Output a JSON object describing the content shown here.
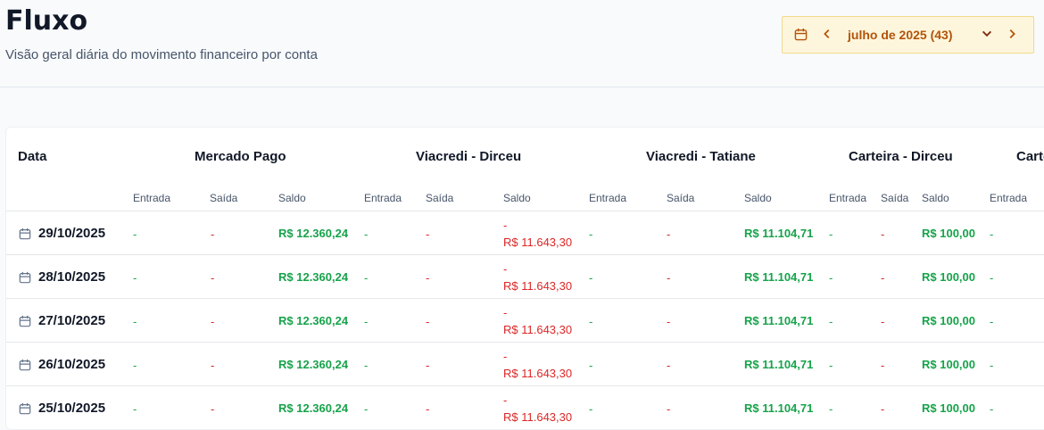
{
  "page": {
    "title": "Fluxo",
    "subtitle": "Visão geral diária do movimento financeiro por conta"
  },
  "month_picker": {
    "label": "julho de 2025 (43)",
    "calendar_icon": "calendar-icon",
    "prev_icon": "chevron-left-icon",
    "dropdown_icon": "chevron-down-icon",
    "next_icon": "chevron-right-icon",
    "accent_color": "#b45309"
  },
  "table": {
    "date_header": "Data",
    "accounts": [
      "Mercado Pago",
      "Viacredi - Dirceu",
      "Viacredi - Tatiane",
      "Carteira - Dirceu",
      "Carte"
    ],
    "sub_headers": [
      "Entrada",
      "Saída",
      "Saldo",
      "Entrada",
      "Saída",
      "Saldo",
      "Entrada",
      "Saída",
      "Saldo",
      "Entrada",
      "Saída",
      "Saldo",
      "Entrada"
    ],
    "rows": [
      {
        "date": "29/10/2025",
        "cells": [
          "-",
          "-",
          "R$ 12.360,24",
          "-",
          "-",
          "-",
          "R$ 11.643,30",
          "-",
          "-",
          "R$ 11.104,71",
          "-",
          "-",
          "R$ 100,00",
          "-"
        ]
      },
      {
        "date": "28/10/2025",
        "cells": [
          "-",
          "-",
          "R$ 12.360,24",
          "-",
          "-",
          "-",
          "R$ 11.643,30",
          "-",
          "-",
          "R$ 11.104,71",
          "-",
          "-",
          "R$ 100,00",
          "-"
        ]
      },
      {
        "date": "27/10/2025",
        "cells": [
          "-",
          "-",
          "R$ 12.360,24",
          "-",
          "-",
          "-",
          "R$ 11.643,30",
          "-",
          "-",
          "R$ 11.104,71",
          "-",
          "-",
          "R$ 100,00",
          "-"
        ]
      },
      {
        "date": "26/10/2025",
        "cells": [
          "-",
          "-",
          "R$ 12.360,24",
          "-",
          "-",
          "-",
          "R$ 11.643,30",
          "-",
          "-",
          "R$ 11.104,71",
          "-",
          "-",
          "R$ 100,00",
          "-"
        ]
      },
      {
        "date": "25/10/2025",
        "cells": [
          "-",
          "-",
          "R$ 12.360,24",
          "-",
          "-",
          "-",
          "R$ 11.643,30",
          "-",
          "-",
          "R$ 11.104,71",
          "-",
          "-",
          "R$ 100,00",
          "-"
        ]
      }
    ],
    "colors": {
      "positive": "#16a34a",
      "negative": "#dc2626"
    }
  }
}
